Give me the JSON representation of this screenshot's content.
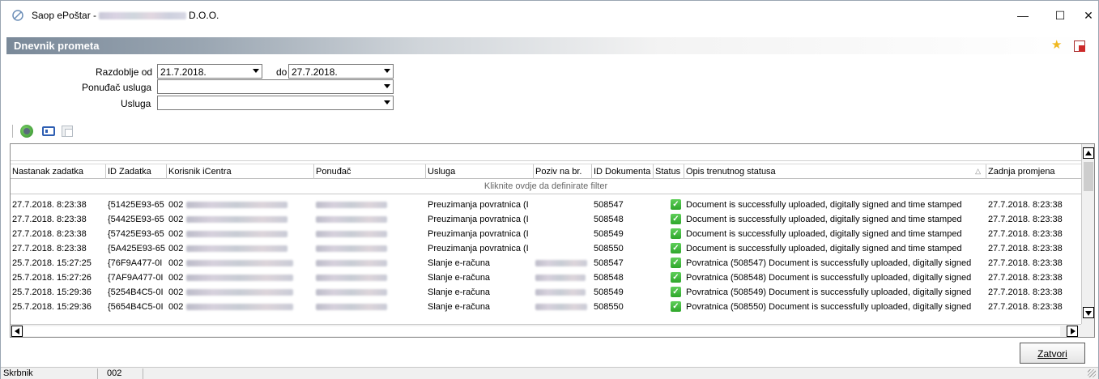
{
  "window": {
    "title_prefix": "Saop ePoštar -",
    "title_suffix": "D.O.O.",
    "min_glyph": "—",
    "max_glyph": "☐",
    "close_glyph": "✕"
  },
  "module": {
    "title": "Dnevnik prometa",
    "star_glyph": "★"
  },
  "filters": {
    "period_from_label": "Razdoblje od",
    "period_from_value": "21.7.2018.",
    "period_to_label": "do",
    "period_to_value": "27.7.2018.",
    "provider_label": "Ponuđač usluga",
    "provider_value": "",
    "service_label": "Usluga",
    "service_value": ""
  },
  "grid": {
    "columns": [
      "Nastanak zadatka",
      "ID Zadatka",
      "Korisnik iCentra",
      "Ponuđač",
      "Usluga",
      "Poziv na br.",
      "ID Dokumenta",
      "Status",
      "Opis trenutnog statusa",
      "Zadnja promjena"
    ],
    "sort_indicator": "△",
    "filter_hint": "Kliknite ovdje da definirate filter",
    "rows": [
      {
        "created": "27.7.2018. 8:23:38",
        "task_id": "{51425E93-65",
        "user": "002",
        "service": "Preuzimanja povratnica (I",
        "doc_id": "508547",
        "status_glyph": "✓",
        "description": "Document is successfully uploaded, digitally signed and time stamped",
        "last_change": "27.7.2018. 8:23:38"
      },
      {
        "created": "27.7.2018. 8:23:38",
        "task_id": "{54425E93-65",
        "user": "002",
        "service": "Preuzimanja povratnica (I",
        "doc_id": "508548",
        "status_glyph": "✓",
        "description": "Document is successfully uploaded, digitally signed and time stamped",
        "last_change": "27.7.2018. 8:23:38"
      },
      {
        "created": "27.7.2018. 8:23:38",
        "task_id": "{57425E93-65",
        "user": "002",
        "service": "Preuzimanja povratnica (I",
        "doc_id": "508549",
        "status_glyph": "✓",
        "description": "Document is successfully uploaded, digitally signed and time stamped",
        "last_change": "27.7.2018. 8:23:38"
      },
      {
        "created": "27.7.2018. 8:23:38",
        "task_id": "{5A425E93-65",
        "user": "002",
        "service": "Preuzimanja povratnica (I",
        "doc_id": "508550",
        "status_glyph": "✓",
        "description": "Document is successfully uploaded, digitally signed and time stamped",
        "last_change": "27.7.2018. 8:23:38"
      },
      {
        "created": "25.7.2018. 15:27:25",
        "task_id": "{76F9A477-0I",
        "user": "002",
        "service": "Slanje e-računa",
        "doc_id": "508547",
        "status_glyph": "✓",
        "description": "Povratnica (508547) Document is successfully uploaded, digitally signed",
        "last_change": "27.7.2018. 8:23:38"
      },
      {
        "created": "25.7.2018. 15:27:26",
        "task_id": "{7AF9A477-0I",
        "user": "002",
        "service": "Slanje e-računa",
        "doc_id": "508548",
        "status_glyph": "✓",
        "description": "Povratnica (508548) Document is successfully uploaded, digitally signed",
        "last_change": "27.7.2018. 8:23:38"
      },
      {
        "created": "25.7.2018. 15:29:36",
        "task_id": "{5254B4C5-0I",
        "user": "002",
        "service": "Slanje e-računa",
        "doc_id": "508549",
        "status_glyph": "✓",
        "description": "Povratnica (508549) Document is successfully uploaded, digitally signed",
        "last_change": "27.7.2018. 8:23:38"
      },
      {
        "created": "25.7.2018. 15:29:36",
        "task_id": "{5654B4C5-0I",
        "user": "002",
        "service": "Slanje e-računa",
        "doc_id": "508550",
        "status_glyph": "✓",
        "description": "Povratnica (508550) Document is successfully uploaded, digitally signed",
        "last_change": "27.7.2018. 8:23:38"
      }
    ]
  },
  "buttons": {
    "close_label": "Zatvori"
  },
  "statusbar": {
    "role": "Skrbnik",
    "code": "002"
  },
  "colors": {
    "header_gradient_start": "#7a8999",
    "status_ok": "#2ea62b",
    "star": "#f0b820",
    "exit_red": "#cc2a2a"
  },
  "icons": {
    "app": "app-logo-icon",
    "favorite": "star-icon",
    "exit": "exit-icon",
    "refresh": "refresh-icon",
    "view": "view-details-icon",
    "copy": "copy-icon",
    "status_ok": "check-icon"
  }
}
